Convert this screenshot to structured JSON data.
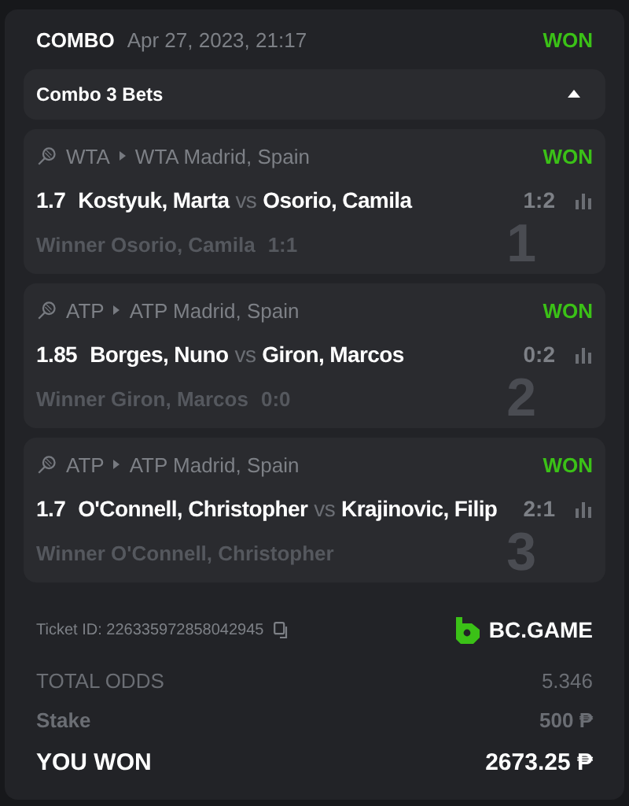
{
  "header": {
    "type": "COMBO",
    "date": "Apr 27, 2023, 21:17",
    "status": "WON"
  },
  "combo": {
    "title": "Combo 3 Bets",
    "expanded": true
  },
  "legs": [
    {
      "league": "WTA",
      "tournament": "WTA Madrid, Spain",
      "status": "WON",
      "odds": "1.7",
      "home": "Kostyuk, Marta",
      "vs": "vs",
      "away": "Osorio, Camila",
      "score": "1:2",
      "market": "Winner Osorio, Camila",
      "market_score": "1:1",
      "index": "1"
    },
    {
      "league": "ATP",
      "tournament": "ATP Madrid, Spain",
      "status": "WON",
      "odds": "1.85",
      "home": "Borges, Nuno",
      "vs": "vs",
      "away": "Giron, Marcos",
      "score": "0:2",
      "market": "Winner Giron, Marcos",
      "market_score": "0:0",
      "index": "2"
    },
    {
      "league": "ATP",
      "tournament": "ATP Madrid, Spain",
      "status": "WON",
      "odds": "1.7",
      "home": "O'Connell, Christopher",
      "vs": "vs",
      "away": "Krajinovic, Filip",
      "score": "2:1",
      "market": "Winner O'Connell, Christopher",
      "index": "3"
    }
  ],
  "ticket": {
    "label": "Ticket ID: 226335972858042945",
    "brand": "BC.GAME"
  },
  "summary": [
    {
      "kind": "odds",
      "label": "TOTAL ODDS",
      "value": "5.346"
    },
    {
      "kind": "stake",
      "label": "Stake",
      "value": "500 ₱"
    },
    {
      "kind": "won",
      "label": "YOU WON",
      "value": "2673.25 ₱"
    }
  ]
}
